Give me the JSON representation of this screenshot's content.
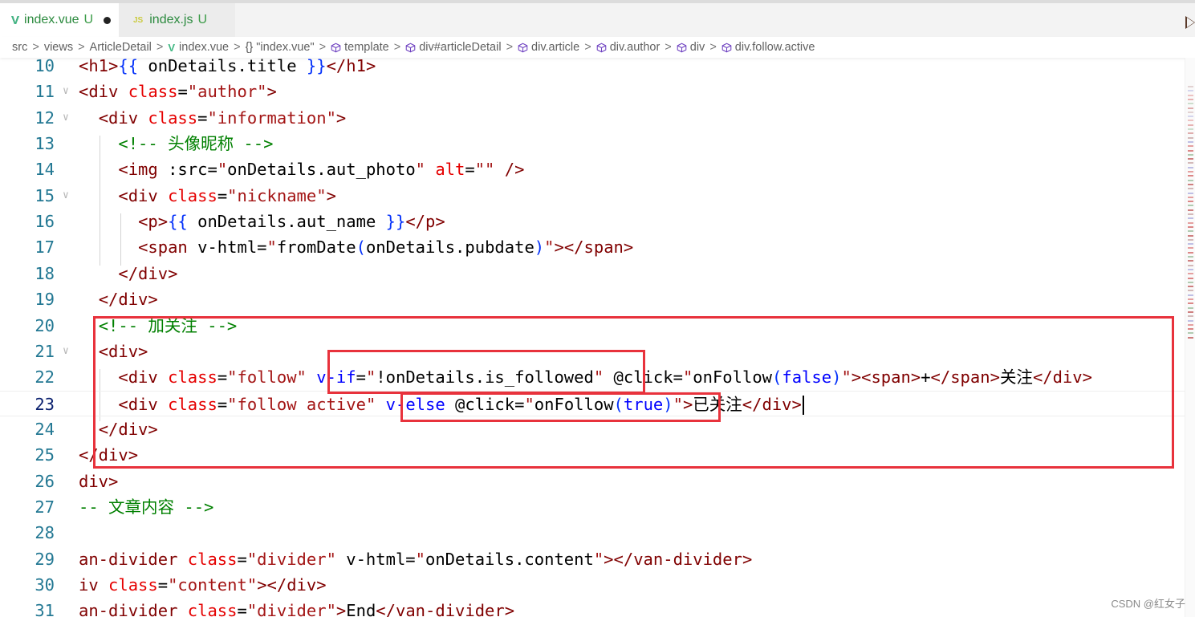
{
  "tabs": [
    {
      "icon": "vue-file-icon",
      "glyph": "V",
      "name": "index.vue",
      "status": "U",
      "modified": true
    },
    {
      "icon": "js-file-icon",
      "glyph": "JS",
      "name": "index.js",
      "status": "U",
      "modified": false
    }
  ],
  "breadcrumb": [
    {
      "label": "src"
    },
    {
      "label": "views"
    },
    {
      "label": "ArticleDetail"
    },
    {
      "label": "index.vue",
      "icon": "vue"
    },
    {
      "label": "\"index.vue\"",
      "icon": "braces",
      "glyph": "{}"
    },
    {
      "label": "template",
      "icon": "cube"
    },
    {
      "label": "div#articleDetail",
      "icon": "cube"
    },
    {
      "label": "div.article",
      "icon": "cube"
    },
    {
      "label": "div.author",
      "icon": "cube"
    },
    {
      "label": "div",
      "icon": "cube"
    },
    {
      "label": "div.follow.active",
      "icon": "cube"
    }
  ],
  "editor": {
    "current_line": 23,
    "lines": [
      {
        "n": "10",
        "tokens": [
          [
            "t-tag",
            "<h1>"
          ],
          [
            "t-brace",
            "{{"
          ],
          [
            "t-txt",
            " onDetails.title "
          ],
          [
            "t-brace",
            "}}"
          ],
          [
            "t-tag",
            "</h1>"
          ]
        ]
      },
      {
        "n": "11",
        "fold": true,
        "tokens": [
          [
            "t-tag",
            "<div "
          ],
          [
            "t-attr",
            "class"
          ],
          [
            "t-txt",
            "="
          ],
          [
            "t-str",
            "\"author\""
          ],
          [
            "t-tag",
            ">"
          ]
        ]
      },
      {
        "n": "12",
        "fold": true,
        "tokens": [
          [
            "t-txt",
            "  "
          ],
          [
            "t-tag",
            "<div "
          ],
          [
            "t-attr",
            "class"
          ],
          [
            "t-txt",
            "="
          ],
          [
            "t-str",
            "\"information\""
          ],
          [
            "t-tag",
            ">"
          ]
        ]
      },
      {
        "n": "13",
        "tokens": [
          [
            "t-txt",
            "    "
          ],
          [
            "t-com",
            "<!-- 头像昵称 -->"
          ]
        ]
      },
      {
        "n": "14",
        "tokens": [
          [
            "t-txt",
            "    "
          ],
          [
            "t-tag",
            "<img "
          ],
          [
            "t-txt",
            ":src="
          ],
          [
            "t-str",
            "\""
          ],
          [
            "t-txt",
            "onDetails.aut_photo"
          ],
          [
            "t-str",
            "\" "
          ],
          [
            "t-attr",
            "alt"
          ],
          [
            "t-txt",
            "="
          ],
          [
            "t-str",
            "\"\""
          ],
          [
            "t-tag",
            " />"
          ]
        ]
      },
      {
        "n": "15",
        "fold": true,
        "tokens": [
          [
            "t-txt",
            "    "
          ],
          [
            "t-tag",
            "<div "
          ],
          [
            "t-attr",
            "class"
          ],
          [
            "t-txt",
            "="
          ],
          [
            "t-str",
            "\"nickname\""
          ],
          [
            "t-tag",
            ">"
          ]
        ]
      },
      {
        "n": "16",
        "tokens": [
          [
            "t-txt",
            "      "
          ],
          [
            "t-tag",
            "<p>"
          ],
          [
            "t-brace",
            "{{"
          ],
          [
            "t-txt",
            " onDetails.aut_name "
          ],
          [
            "t-brace",
            "}}"
          ],
          [
            "t-tag",
            "</p>"
          ]
        ]
      },
      {
        "n": "17",
        "tokens": [
          [
            "t-txt",
            "      "
          ],
          [
            "t-tag",
            "<span "
          ],
          [
            "t-txt",
            "v-html="
          ],
          [
            "t-str",
            "\""
          ],
          [
            "t-txt",
            "fromDate"
          ],
          [
            "t-paren",
            "("
          ],
          [
            "t-txt",
            "onDetails.pubdate"
          ],
          [
            "t-paren",
            ")"
          ],
          [
            "t-str",
            "\""
          ],
          [
            "t-tag",
            "></span>"
          ]
        ]
      },
      {
        "n": "18",
        "tokens": [
          [
            "t-txt",
            "    "
          ],
          [
            "t-tag",
            "</div>"
          ]
        ]
      },
      {
        "n": "19",
        "tokens": [
          [
            "t-txt",
            "  "
          ],
          [
            "t-tag",
            "</div>"
          ]
        ]
      },
      {
        "n": "20",
        "tokens": [
          [
            "t-txt",
            "  "
          ],
          [
            "t-com",
            "<!-- 加关注 -->"
          ]
        ]
      },
      {
        "n": "21",
        "fold": true,
        "tokens": [
          [
            "t-txt",
            "  "
          ],
          [
            "t-tag",
            "<div>"
          ]
        ]
      },
      {
        "n": "22",
        "tokens": [
          [
            "t-txt",
            "    "
          ],
          [
            "t-tag",
            "<div "
          ],
          [
            "t-attr",
            "class"
          ],
          [
            "t-txt",
            "="
          ],
          [
            "t-str",
            "\"follow\" "
          ],
          [
            "t-dir",
            "v-if"
          ],
          [
            "t-txt",
            "="
          ],
          [
            "t-str",
            "\""
          ],
          [
            "t-txt",
            "!onDetails.is_followed"
          ],
          [
            "t-str",
            "\" "
          ],
          [
            "t-txt",
            "@click="
          ],
          [
            "t-str",
            "\""
          ],
          [
            "t-txt",
            "onFollow"
          ],
          [
            "t-paren",
            "("
          ],
          [
            "t-kw",
            "false"
          ],
          [
            "t-paren",
            ")"
          ],
          [
            "t-str",
            "\""
          ],
          [
            "t-tag",
            "><span>"
          ],
          [
            "t-txt",
            "+"
          ],
          [
            "t-tag",
            "</span>"
          ],
          [
            "t-txt",
            "关注"
          ],
          [
            "t-tag",
            "</div>"
          ]
        ]
      },
      {
        "n": "23",
        "cursor": true,
        "tokens": [
          [
            "t-txt",
            "    "
          ],
          [
            "t-tag",
            "<div "
          ],
          [
            "t-attr",
            "class"
          ],
          [
            "t-txt",
            "="
          ],
          [
            "t-str",
            "\"follow active\" "
          ],
          [
            "t-dir",
            "v-else "
          ],
          [
            "t-txt",
            "@click="
          ],
          [
            "t-str",
            "\""
          ],
          [
            "t-txt",
            "onFollow"
          ],
          [
            "t-paren",
            "("
          ],
          [
            "t-kw",
            "true"
          ],
          [
            "t-paren",
            ")"
          ],
          [
            "t-str",
            "\""
          ],
          [
            "t-tag",
            ">"
          ],
          [
            "t-txt",
            "已关注"
          ],
          [
            "t-tag",
            "</div>"
          ]
        ]
      },
      {
        "n": "24",
        "tokens": [
          [
            "t-txt",
            "  "
          ],
          [
            "t-tag",
            "</div>"
          ]
        ]
      },
      {
        "n": "25",
        "tokens": [
          [
            "t-tag",
            "</div>"
          ]
        ]
      },
      {
        "n": "26",
        "tokens": [
          [
            "t-tag",
            "div>"
          ]
        ]
      },
      {
        "n": "27",
        "tokens": [
          [
            "t-com",
            "-- 文章内容 -->"
          ]
        ]
      },
      {
        "n": "28",
        "tokens": []
      },
      {
        "n": "29",
        "tokens": [
          [
            "t-tag",
            "an-divider "
          ],
          [
            "t-attr",
            "class"
          ],
          [
            "t-txt",
            "="
          ],
          [
            "t-str",
            "\"divider\" "
          ],
          [
            "t-txt",
            "v-html="
          ],
          [
            "t-str",
            "\""
          ],
          [
            "t-txt",
            "onDetails.content"
          ],
          [
            "t-str",
            "\""
          ],
          [
            "t-tag",
            "></van-divider>"
          ]
        ]
      },
      {
        "n": "30",
        "tokens": [
          [
            "t-tag",
            "iv "
          ],
          [
            "t-attr",
            "class"
          ],
          [
            "t-txt",
            "="
          ],
          [
            "t-str",
            "\"content\""
          ],
          [
            "t-tag",
            "></div>"
          ]
        ]
      },
      {
        "n": "31",
        "tokens": [
          [
            "t-tag",
            "an-divider "
          ],
          [
            "t-attr",
            "class"
          ],
          [
            "t-txt",
            "="
          ],
          [
            "t-str",
            "\"divider\""
          ],
          [
            "t-tag",
            ">"
          ],
          [
            "t-txt",
            "End"
          ],
          [
            "t-tag",
            "</van-divider>"
          ]
        ]
      }
    ]
  },
  "annotations": {
    "highlight_color": "#e8323c",
    "boxes": [
      "follow-block",
      "v-if-condition",
      "v-else-click"
    ]
  },
  "watermark": "CSDN @红女子"
}
